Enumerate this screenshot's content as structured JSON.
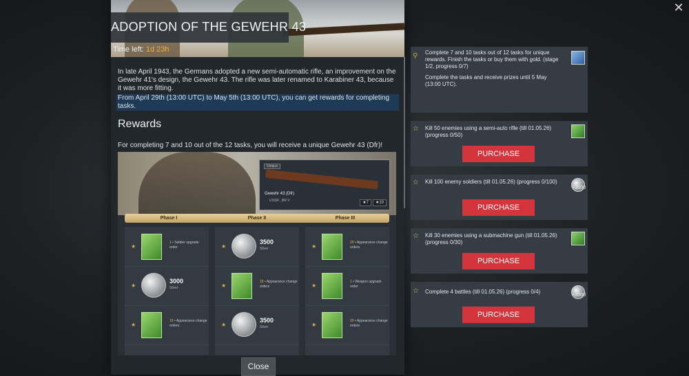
{
  "window": {
    "close_glyph": "✕"
  },
  "left": {
    "title": "ADOPTION OF THE GEWEHR 43",
    "time_left_label": "Time left:",
    "time_left_value": "1d 23h",
    "para1": "In late April 1943, the Germans adopted a new semi-automatic rifle, an improvement on the Gewehr 41's design, the Gewehr 43. The rifle was later renamed to Karabiner 43, because it was more fitting.",
    "para2": "From April 29th (13:00 UTC) to May 5th (13:00 UTC), you can get rewards for completing tasks.",
    "rewards_heading": "Rewards",
    "rewards_sub": "For completing 7 and 10 out of the 12 tasks, you will receive a unique Gewehr 43 (Dfr)!",
    "weapon": {
      "badge": "Unique",
      "name": "Gewehr 43 (Dfr)",
      "nation": "USSR , BR V",
      "stat1": "★7",
      "stat2": "★10"
    },
    "phases": [
      "Phase I",
      "Phase II",
      "Phase III"
    ],
    "grid": [
      [
        {
          "value": "1",
          "text": "Soldier upgrade order",
          "type": "box"
        },
        {
          "value": "3000",
          "text": "Silver",
          "type": "silver"
        },
        {
          "value": "15",
          "text": "Appearance change orders",
          "type": "box"
        }
      ],
      [
        {
          "value": "3500",
          "text": "Silver",
          "type": "silver"
        },
        {
          "value": "15",
          "text": "Appearance change orders",
          "type": "box"
        },
        {
          "value": "3500",
          "text": "Silver",
          "type": "silver"
        }
      ],
      [
        {
          "value": "20",
          "text": "Appearance change orders",
          "type": "box"
        },
        {
          "value": "1",
          "text": "Weapon upgrade order",
          "type": "box"
        },
        {
          "value": "20",
          "text": "Appearance change orders",
          "type": "box"
        }
      ]
    ],
    "close_button": "Close"
  },
  "tasks": [
    {
      "text": "Complete 7 and 10 tasks out of 12 tasks for unique rewards. Finish the tasks or buy them with gold. (stage 1/2, progress 0/7)",
      "text2": "Complete the tasks and receive prizes until 5 May (13:00 UTC).",
      "icon": "medal-icon"
    },
    {
      "text": "Kill 50 enemies using a semi-auto rifle (till 01.05.26) (progress 0/50)",
      "button": "PURCHASE",
      "icon": "star-badge-icon"
    },
    {
      "text": "Kill 100 enemy soldiers (till 01.05.26) (progress 0/100)",
      "button": "PURCHASE",
      "icon": "silver-coin-icon",
      "multiplier": "×3000"
    },
    {
      "text": "Kill 30 enemies using a submachine gun (till 01.05.26) (progress 0/30)",
      "button": "PURCHASE",
      "icon": "appearance-order-icon"
    },
    {
      "text": "Complete 4 battles (till 01.05.26) (progress 0/4)",
      "button": "PURCHASE",
      "icon": "silver-coin-icon",
      "multiplier": "×2000"
    }
  ]
}
